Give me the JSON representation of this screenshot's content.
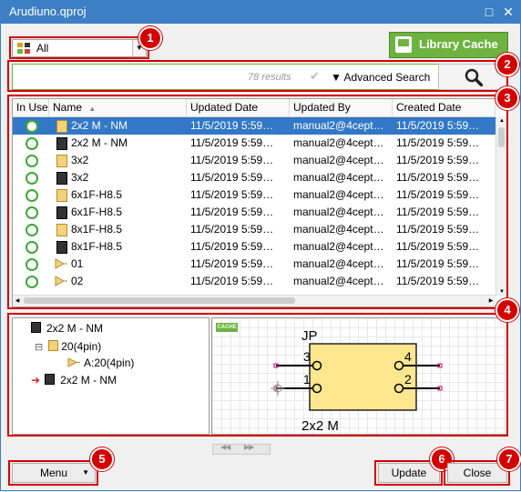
{
  "window": {
    "title": "Arudiuno.qproj",
    "maximize_glyph": "□",
    "close_glyph": "✕"
  },
  "filter": {
    "selected": "All"
  },
  "library_cache": {
    "label": "Library Cache",
    "color": "#6cb33f"
  },
  "search": {
    "results_text": "78 results",
    "check_glyph": "✔",
    "advanced_label": "▼ Advanced Search"
  },
  "table": {
    "columns": [
      "In Use",
      "Name",
      "Updated Date",
      "Updated By",
      "Created Date"
    ],
    "sort_glyph": "▲",
    "rows": [
      {
        "icon": "light-chip-icon",
        "name": "2x2 M - NM",
        "updated": "11/5/2019 5:59…",
        "by": "manual2@4cept…",
        "created": "11/5/2019 5:59…",
        "selected": true
      },
      {
        "icon": "dark-chip-icon",
        "name": "2x2 M - NM",
        "updated": "11/5/2019 5:59…",
        "by": "manual2@4cept…",
        "created": "11/5/2019 5:59…"
      },
      {
        "icon": "light-chip-icon",
        "name": "3x2",
        "updated": "11/5/2019 5:59…",
        "by": "manual2@4cept…",
        "created": "11/5/2019 5:59…"
      },
      {
        "icon": "dark-chip-icon",
        "name": "3x2",
        "updated": "11/5/2019 5:59…",
        "by": "manual2@4cept…",
        "created": "11/5/2019 5:59…"
      },
      {
        "icon": "light-chip-icon",
        "name": "6x1F-H8.5",
        "updated": "11/5/2019 5:59…",
        "by": "manual2@4cept…",
        "created": "11/5/2019 5:59…"
      },
      {
        "icon": "dark-chip-icon",
        "name": "6x1F-H8.5",
        "updated": "11/5/2019 5:59…",
        "by": "manual2@4cept…",
        "created": "11/5/2019 5:59…"
      },
      {
        "icon": "light-chip-icon",
        "name": "8x1F-H8.5",
        "updated": "11/5/2019 5:59…",
        "by": "manual2@4cept…",
        "created": "11/5/2019 5:59…"
      },
      {
        "icon": "dark-chip-icon",
        "name": "8x1F-H8.5",
        "updated": "11/5/2019 5:59…",
        "by": "manual2@4cept…",
        "created": "11/5/2019 5:59…"
      },
      {
        "icon": "symbol-icon",
        "name": "01",
        "updated": "11/5/2019 5:59…",
        "by": "manual2@4cept…",
        "created": "11/5/2019 5:59…"
      },
      {
        "icon": "symbol-icon",
        "name": "02",
        "updated": "11/5/2019 5:59…",
        "by": "manual2@4cept…",
        "created": "11/5/2019 5:59…"
      }
    ]
  },
  "tree": {
    "root": "2x2 M - NM",
    "child": "20(4pin)",
    "leaf": "A:20(4pin)",
    "sibling": "2x2 M - NM",
    "collapse_glyph": "⊟"
  },
  "preview": {
    "cache_badge": "CACHE",
    "ref": "JP",
    "pins": [
      "3",
      "4",
      "1",
      "2"
    ],
    "value": "2x2 M"
  },
  "buttons": {
    "menu": "Menu",
    "update": "Update",
    "close": "Close"
  },
  "badges": [
    "1",
    "2",
    "3",
    "4",
    "5",
    "6",
    "7"
  ]
}
